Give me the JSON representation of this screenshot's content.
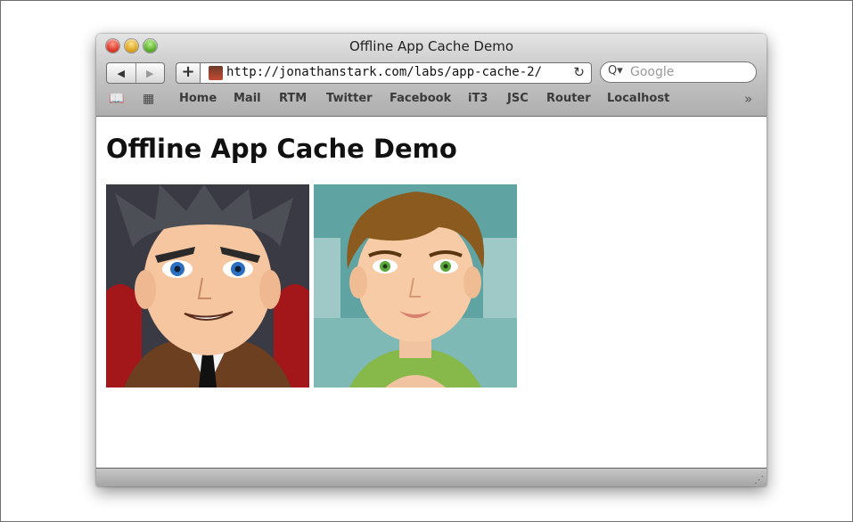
{
  "window": {
    "title": "Offline App Cache Demo"
  },
  "toolbar": {
    "back_glyph": "◀",
    "forward_glyph": "▶",
    "add_glyph": "+",
    "url": "http://jonathanstark.com/labs/app-cache-2/",
    "reload_glyph": "↻",
    "search_icon_glyph": "Q▾",
    "search_placeholder": "Google"
  },
  "bookmarks": {
    "book_glyph": "📖",
    "grid_glyph": "▦",
    "overflow_glyph": "»",
    "items": [
      "Home",
      "Mail",
      "RTM",
      "Twitter",
      "Facebook",
      "iT3",
      "JSC",
      "Router",
      "Localhost"
    ]
  },
  "page": {
    "heading": "Offline App Cache Demo"
  },
  "icons": {
    "close": "close-icon",
    "minimize": "minimize-icon",
    "zoom": "zoom-icon",
    "favicon": "favicon-icon",
    "resize": "resize-grip-icon"
  },
  "colors": {
    "close": "#d42a1c",
    "minimize": "#d69a10",
    "zoom": "#4ea320"
  },
  "status_bar": {
    "grip_glyph": "⋰"
  }
}
